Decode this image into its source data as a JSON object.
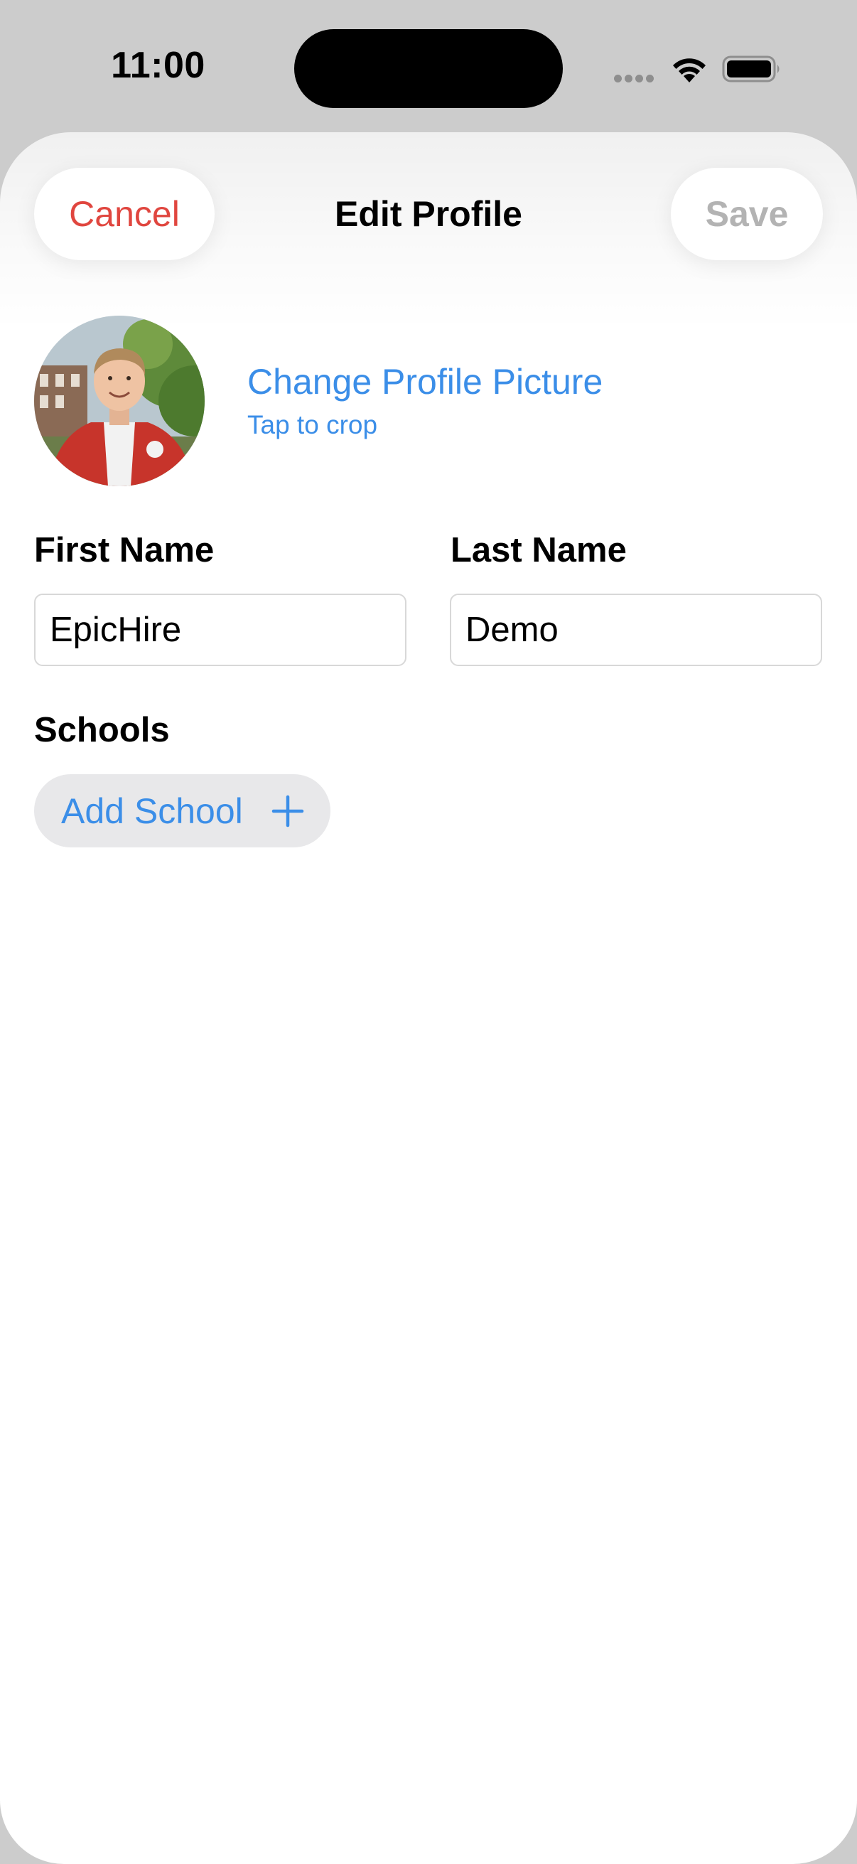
{
  "status_bar": {
    "time": "11:00",
    "icons": [
      "signal-dots-icon",
      "wifi-icon",
      "battery-icon"
    ]
  },
  "nav": {
    "cancel_label": "Cancel",
    "title": "Edit Profile",
    "save_label": "Save"
  },
  "profile_picture": {
    "change_label": "Change Profile Picture",
    "hint": "Tap to crop"
  },
  "fields": {
    "first_name": {
      "label": "First Name",
      "value": "EpicHire"
    },
    "last_name": {
      "label": "Last Name",
      "value": "Demo"
    }
  },
  "schools": {
    "label": "Schools",
    "add_label": "Add School"
  },
  "colors": {
    "accent": "#3b8ee8",
    "cancel": "#e0463f",
    "save_disabled": "#b3b3b3",
    "backdrop": "#cccccc"
  }
}
